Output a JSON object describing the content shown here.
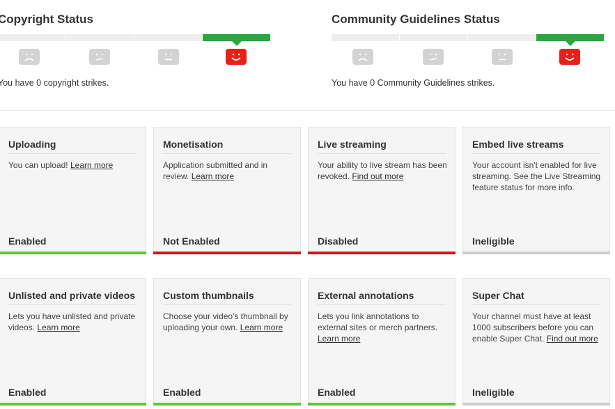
{
  "copyright": {
    "title": "Copyright Status",
    "message": "You have 0 copyright strikes.",
    "active_segment": 4
  },
  "community": {
    "title": "Community Guidelines Status",
    "message": "You have 0 Community Guidelines strikes.",
    "active_segment": 4
  },
  "colors": {
    "good": "#2ba640",
    "bad": "#cc181e",
    "neutral": "#cccccc",
    "meter_active": "#2ba640",
    "face_active": "#e62117",
    "face_inactive": "#d3d3d3"
  },
  "features": [
    {
      "title": "Uploading",
      "desc": "You can upload!",
      "link": "Learn more",
      "status": "Enabled",
      "status_color": "#5ec53d"
    },
    {
      "title": "Monetisation",
      "desc": "Application submitted and in review.",
      "link": "Learn more",
      "status": "Not Enabled",
      "status_color": "#cc181e"
    },
    {
      "title": "Live streaming",
      "desc": "Your ability to live stream has been revoked.",
      "link": "Find out more",
      "status": "Disabled",
      "status_color": "#cc181e"
    },
    {
      "title": "Embed live streams",
      "desc": "Your account isn't enabled for live streaming. See the Live Streaming feature status for more info.",
      "link": "",
      "status": "Ineligible",
      "status_color": "#cccccc"
    },
    {
      "title": "Unlisted and private videos",
      "desc": "Lets you have unlisted and private videos.",
      "link": "Learn more",
      "status": "Enabled",
      "status_color": "#5ec53d"
    },
    {
      "title": "Custom thumbnails",
      "desc": "Choose your video's thumbnail by uploading your own.",
      "link": "Learn more",
      "status": "Enabled",
      "status_color": "#5ec53d"
    },
    {
      "title": "External annotations",
      "desc": "Lets you link annotations to external sites or merch partners.",
      "link": "Learn more",
      "status": "Enabled",
      "status_color": "#5ec53d"
    },
    {
      "title": "Super Chat",
      "desc": "Your channel must have at least 1000 subscribers before you can enable Super Chat.",
      "link": "Find out more",
      "status": "Ineligible",
      "status_color": "#cccccc"
    }
  ]
}
